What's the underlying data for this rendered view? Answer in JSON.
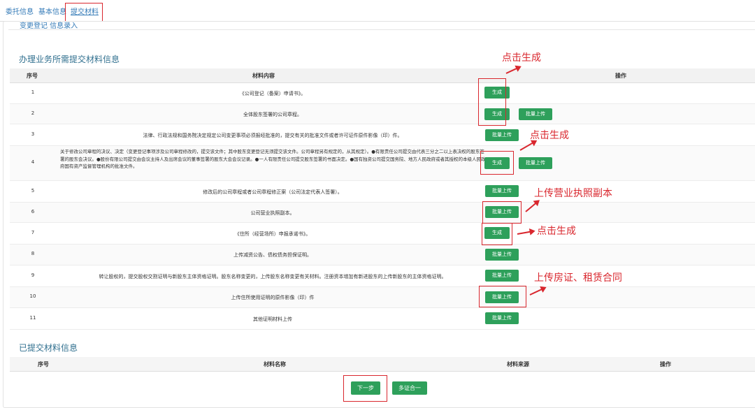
{
  "tabs": [
    {
      "label": "委托信息"
    },
    {
      "label": "基本信息"
    },
    {
      "label": "提交材料"
    }
  ],
  "subtitle": "变更登记 信息录入",
  "section1": {
    "title": "办理业务所需提交材料信息",
    "headers": {
      "no": "序号",
      "content": "材料内容",
      "ops": "操作"
    }
  },
  "rows": [
    {
      "no": "1",
      "text": "《公司登记（备案）申请书》。",
      "gen": "生成"
    },
    {
      "no": "2",
      "text": "全体股东签署的公司章程。",
      "gen": "生成",
      "up": "批量上传"
    },
    {
      "no": "3",
      "text": "法律、行政法规和国务院决定规定公司变更事项必须报经批准的，提交有关的批准文件或者许可证件原件影像（印）件。",
      "up": "批量上传"
    },
    {
      "no": "4",
      "text": "关于修改公司章程的决议、决定（变更登记事项涉及公司章程修改的，提交该文件；其中股东变更登记无须提交该文件。公司章程另有规定的，从其规定）。●有限责任公司提交由代表三分之二以上表决权的股东签署的股东会决议。●股份有限公司提交由会议主持人及出席会议的董事签署的股东大会会议记录。●一人有限责任公司提交股东签署的书面决定。●国有独资公司提交国务院、地方人民政府或者其授权的本级人民政府国有资产监督管理机构的批准文件。",
      "gen": "生成",
      "up": "批量上传"
    },
    {
      "no": "5",
      "text": "修改后的公司章程或者公司章程修正案（公司法定代表人签署）。",
      "up": "批量上传"
    },
    {
      "no": "6",
      "text": "公司营业执照副本。",
      "up": "批量上传"
    },
    {
      "no": "7",
      "text": "《住所（经营场所）申报承诺书》。",
      "gen": "生成"
    },
    {
      "no": "8",
      "text": "上传减资公告、债权债务担保证明。",
      "up": "批量上传"
    },
    {
      "no": "9",
      "text": "转让股权的，提交股权交割证明与新股东主体资格证明。股东名称变更的，上传股东名称变更有关材料。注册资本增加有新进股东的上传新股东的主体资格证明。",
      "up": "批量上传"
    },
    {
      "no": "10",
      "text": "上传住所使用证明的原件影像（印）件",
      "up": "批量上传"
    },
    {
      "no": "11",
      "text": "其他证明材料上传",
      "up": "批量上传"
    }
  ],
  "section2": {
    "title": "已提交材料信息",
    "headers": {
      "no": "序号",
      "name": "材料名称",
      "source": "材料来源",
      "ops": "操作"
    }
  },
  "footer": {
    "next": "下一步",
    "multi": "多证合一"
  },
  "annotations": {
    "a1": "点击生成",
    "a2": "点击生成",
    "a3": "上传营业执照副本",
    "a4": "点击生成",
    "a5": "上传房证、租赁合同"
  },
  "colors": {
    "accent": "#2ea05b",
    "annotation": "#d9272e",
    "title": "#31708f"
  }
}
